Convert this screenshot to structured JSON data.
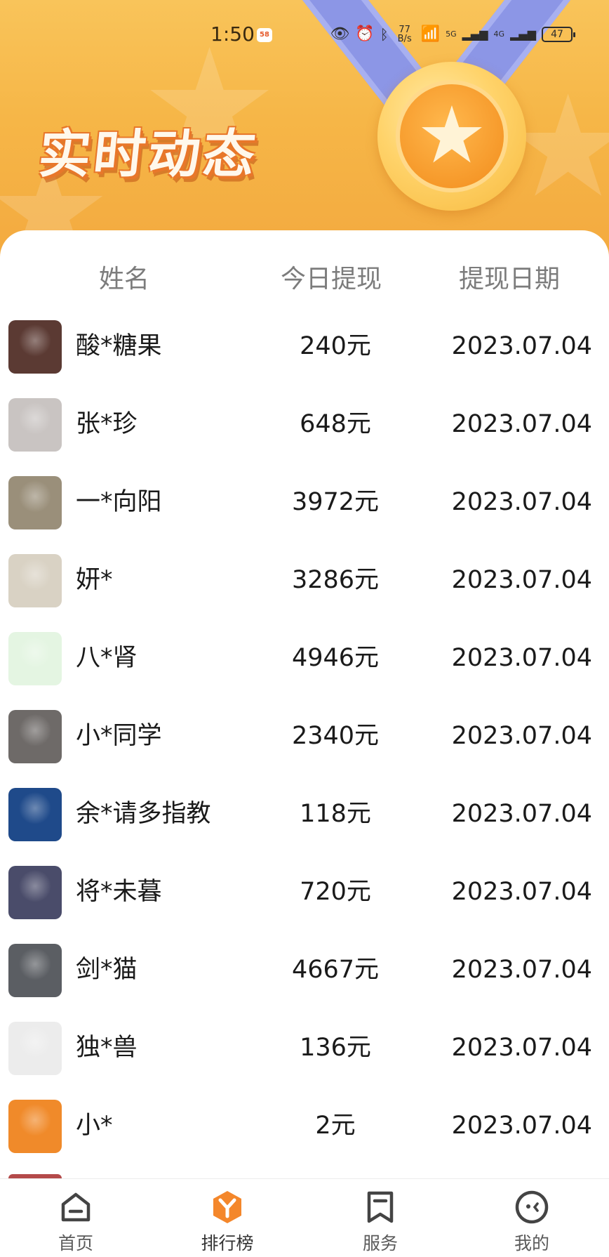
{
  "status_bar": {
    "time": "1:50",
    "app_badge": "58",
    "net_speed_value": "77",
    "net_speed_unit": "B/s",
    "signal_1_label": "5G",
    "signal_2_label": "4G",
    "battery": "47"
  },
  "header": {
    "title": "实时动态"
  },
  "table": {
    "columns": [
      "姓名",
      "今日提现",
      "提现日期"
    ],
    "rows": [
      {
        "name": "酸*糖果",
        "amount": "240元",
        "date": "2023.07.04"
      },
      {
        "name": "张*珍",
        "amount": "648元",
        "date": "2023.07.04"
      },
      {
        "name": "一*向阳",
        "amount": "3972元",
        "date": "2023.07.04"
      },
      {
        "name": "妍*",
        "amount": "3286元",
        "date": "2023.07.04"
      },
      {
        "name": "八*肾",
        "amount": "4946元",
        "date": "2023.07.04"
      },
      {
        "name": "小*同学",
        "amount": "2340元",
        "date": "2023.07.04"
      },
      {
        "name": "余*请多指教",
        "amount": "118元",
        "date": "2023.07.04"
      },
      {
        "name": "将*未暮",
        "amount": "720元",
        "date": "2023.07.04"
      },
      {
        "name": "剑*猫",
        "amount": "4667元",
        "date": "2023.07.04"
      },
      {
        "name": "独*兽",
        "amount": "136元",
        "date": "2023.07.04"
      },
      {
        "name": "小*",
        "amount": "2元",
        "date": "2023.07.04"
      }
    ]
  },
  "avatar_colors": [
    "#5b3a33",
    "#c9c4c2",
    "#9a8f7a",
    "#d9d2c4",
    "#e4f5e2",
    "#6e6a68",
    "#1f4a8a",
    "#4a4c6a",
    "#5b5e63",
    "#ececec",
    "#f08a2a"
  ],
  "avatar_icons": [
    "woman-portrait",
    "husky-dog",
    "bird-on-ground",
    "ink-sketch-figure",
    "seedling",
    "man-with-cat",
    "peacock",
    "anime-character",
    "man-with-hat",
    "calligraphy-portrait",
    "cartoon-man"
  ],
  "bottom_nav": {
    "items": [
      {
        "label": "首页",
        "icon": "home-icon"
      },
      {
        "label": "排行榜",
        "icon": "ranking-icon"
      },
      {
        "label": "服务",
        "icon": "bookmark-icon"
      },
      {
        "label": "我的",
        "icon": "profile-face-icon"
      }
    ],
    "active_index": 1,
    "accent_color": "#f4872b"
  }
}
